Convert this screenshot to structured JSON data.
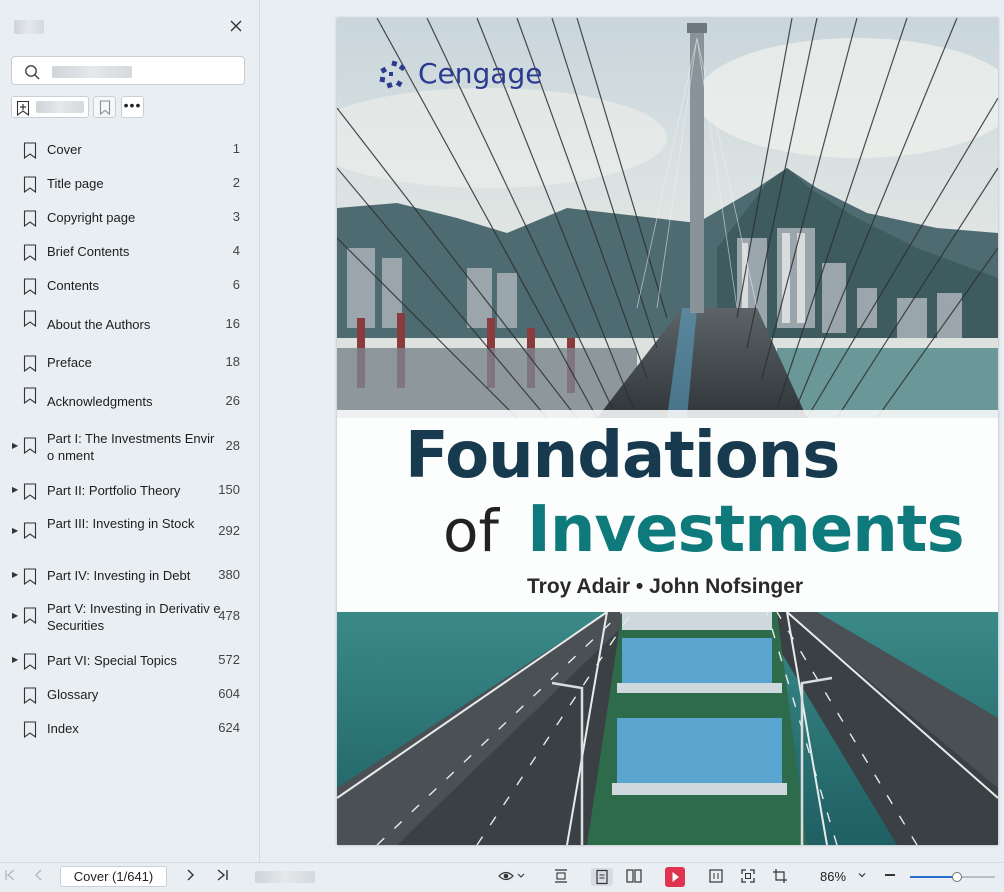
{
  "sidebar": {
    "search": {
      "placeholder": ""
    },
    "toc": [
      {
        "label": "Cover",
        "page": "1",
        "expandable": false
      },
      {
        "label": "Title page",
        "page": "2",
        "expandable": false
      },
      {
        "label": "Copyright page",
        "page": "3",
        "expandable": false
      },
      {
        "label": "Brief Contents",
        "page": "4",
        "expandable": false
      },
      {
        "label": "Contents",
        "page": "6",
        "expandable": false
      },
      {
        "label": "About the Authors",
        "page": "16",
        "expandable": false
      },
      {
        "label": "Preface",
        "page": "18",
        "expandable": false
      },
      {
        "label": "Acknowledgments",
        "page": "26",
        "expandable": false
      },
      {
        "label": "Part I: The Investments Enviro nment",
        "page": "28",
        "expandable": true
      },
      {
        "label": "Part II: Portfolio Theory",
        "page": "150",
        "expandable": true
      },
      {
        "label": "Part III: Investing in Stock",
        "page": "292",
        "expandable": true
      },
      {
        "label": "Part IV: Investing in Debt",
        "page": "380",
        "expandable": true
      },
      {
        "label": "Part V: Investing in Derivativ e Securities",
        "page": "478",
        "expandable": true
      },
      {
        "label": "Part VI: Special Topics",
        "page": "572",
        "expandable": true
      },
      {
        "label": "Glossary",
        "page": "604",
        "expandable": false
      },
      {
        "label": "Index",
        "page": "624",
        "expandable": false
      }
    ]
  },
  "cover": {
    "publisher": "Cengage",
    "title_line1": "Foundations",
    "title_of": "of",
    "title_line2": "Investments",
    "authors": "Troy Adair • John Nofsinger"
  },
  "statusbar": {
    "page_indicator": "Cover (1/641)",
    "zoom": "86%",
    "zoom_fraction": 0.55
  },
  "colors": {
    "accent": "#2b6cd3",
    "brand": "#2b3b8f",
    "title_dark": "#173a4f",
    "title_teal": "#0e7a7c",
    "play": "#e0334f"
  }
}
